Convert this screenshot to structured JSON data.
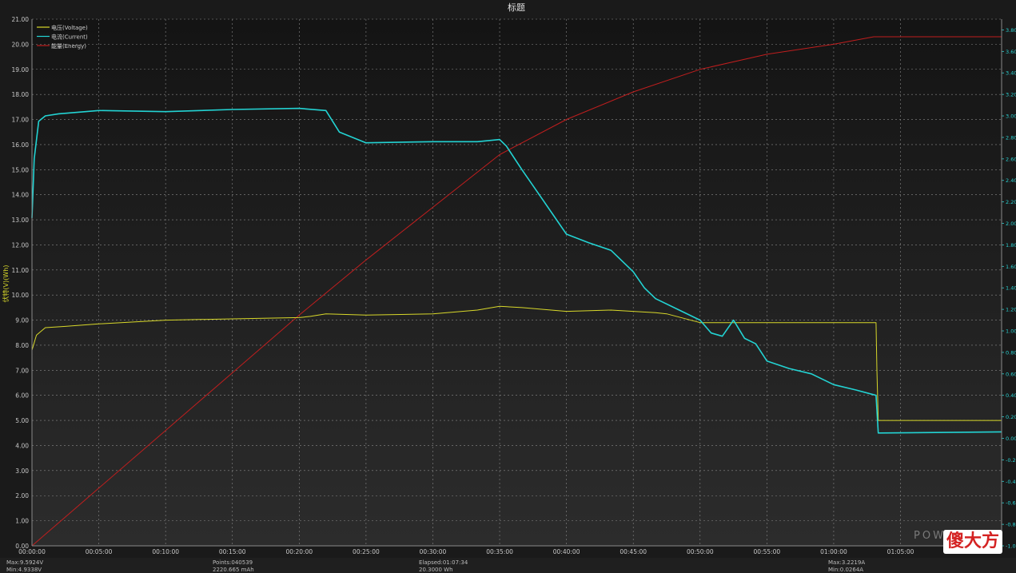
{
  "chart_data": {
    "type": "line",
    "title": "标题",
    "ylabel": "伏特(V)(Wh)",
    "xlabel": "",
    "xlim_seconds": [
      0,
      4354
    ],
    "ylim_left": [
      0,
      21
    ],
    "ylim_right": [
      -1.0,
      3.9
    ],
    "grid": true,
    "legend_position": "top-left",
    "x_tick_labels": [
      "00:00:00",
      "00:05:00",
      "00:10:00",
      "00:15:00",
      "00:20:00",
      "00:25:00",
      "00:30:00",
      "00:35:00",
      "00:40:00",
      "00:45:00",
      "00:50:00",
      "00:55:00",
      "01:00:00",
      "01:05:00"
    ],
    "y_left_tick_labels": [
      "0.00",
      "1.00",
      "2.00",
      "3.00",
      "4.00",
      "5.00",
      "6.00",
      "7.00",
      "8.00",
      "9.00",
      "10.00",
      "11.00",
      "12.00",
      "13.00",
      "14.00",
      "15.00",
      "16.00",
      "17.00",
      "18.00",
      "19.00",
      "20.00",
      "21.00"
    ],
    "y_right_tick_labels": [
      "-1.00",
      "-0.80",
      "-0.60",
      "-0.40",
      "-0.20",
      "0.00",
      "0.20",
      "0.40",
      "0.60",
      "0.80",
      "1.00",
      "1.20",
      "1.40",
      "1.60",
      "1.80",
      "2.00",
      "2.20",
      "2.40",
      "2.60",
      "2.80",
      "3.00",
      "3.20",
      "3.40",
      "3.60",
      "3.80"
    ],
    "series": [
      {
        "name": "电压(Voltage)",
        "axis": "left",
        "color": "#d8d82a",
        "x": [
          0,
          20,
          60,
          150,
          300,
          600,
          900,
          1200,
          1250,
          1320,
          1500,
          1800,
          2000,
          2100,
          2200,
          2400,
          2600,
          2800,
          2850,
          3000,
          3100,
          3400,
          3600,
          3790,
          3794,
          3800,
          4354
        ],
        "y": [
          7.8,
          8.4,
          8.7,
          8.75,
          8.85,
          9.0,
          9.05,
          9.1,
          9.15,
          9.25,
          9.2,
          9.25,
          9.4,
          9.55,
          9.5,
          9.35,
          9.4,
          9.3,
          9.25,
          8.9,
          8.9,
          8.9,
          8.9,
          8.9,
          7.0,
          5.0,
          5.0
        ]
      },
      {
        "name": "电流(Current)",
        "axis": "right",
        "color": "#23d3d3",
        "x": [
          0,
          10,
          30,
          60,
          120,
          300,
          600,
          900,
          1200,
          1320,
          1380,
          1500,
          1800,
          2000,
          2100,
          2130,
          2200,
          2300,
          2400,
          2500,
          2600,
          2700,
          2750,
          2800,
          2900,
          3000,
          3050,
          3100,
          3150,
          3200,
          3250,
          3300,
          3400,
          3500,
          3600,
          3700,
          3790,
          3800,
          4354
        ],
        "y": [
          2.05,
          2.6,
          2.95,
          3.0,
          3.02,
          3.05,
          3.04,
          3.06,
          3.07,
          3.05,
          2.85,
          2.75,
          2.76,
          2.76,
          2.78,
          2.72,
          2.5,
          2.2,
          1.9,
          1.82,
          1.75,
          1.55,
          1.4,
          1.3,
          1.2,
          1.1,
          0.98,
          0.95,
          1.1,
          0.93,
          0.88,
          0.72,
          0.65,
          0.6,
          0.5,
          0.45,
          0.4,
          0.05,
          0.06
        ]
      },
      {
        "name": "能量(Energy)",
        "axis": "left",
        "color": "#c01e1e",
        "x": [
          0,
          300,
          600,
          900,
          1200,
          1500,
          1800,
          2100,
          2400,
          2700,
          3000,
          3300,
          3600,
          3780,
          3800,
          4354
        ],
        "y": [
          0.0,
          2.3,
          4.6,
          6.9,
          9.2,
          11.4,
          13.5,
          15.6,
          17.0,
          18.1,
          19.0,
          19.6,
          20.0,
          20.3,
          20.3,
          20.3
        ]
      }
    ]
  },
  "footer": {
    "max_voltage": "Max:9.5924V",
    "min_voltage": "Min:4.9338V",
    "points": "Points:040539",
    "capacity": "2220.665 mAh",
    "elapsed": "Elapsed:01:07:34",
    "energy": "20.3000 Wh",
    "max_current": "Max:3.2219A",
    "min_current": "Min:0.0264A"
  },
  "watermarks": {
    "logo_text": "POW",
    "stamp_text": "傻大方"
  },
  "colors": {
    "background": "#1b1b1b",
    "plot_background": "#1f1f1f",
    "grid": "#8a8a8a",
    "left_axis_text": "#c8c8c8",
    "right_axis_text": "#2ad0d0",
    "ylabel_text": "#d8d82a"
  }
}
